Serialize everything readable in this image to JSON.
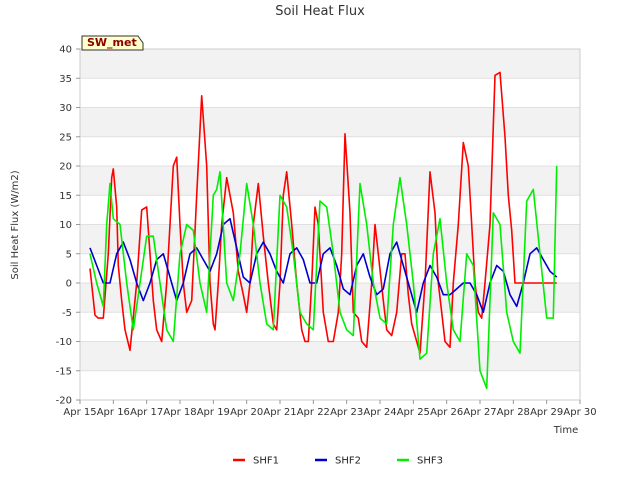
{
  "chart_data": {
    "type": "line",
    "title": "Soil Heat Flux",
    "xlabel": "Time",
    "ylabel": "Soil Heat Flux (W/m2)",
    "site_label": "SW_met",
    "xlim": [
      15,
      30
    ],
    "ylim": [
      -20,
      40
    ],
    "x_ticks": [
      15,
      16,
      17,
      18,
      19,
      20,
      21,
      22,
      23,
      24,
      25,
      26,
      27,
      28,
      29,
      30
    ],
    "x_tick_labels": [
      "Apr 15",
      "Apr 16",
      "Apr 17",
      "Apr 18",
      "Apr 19",
      "Apr 20",
      "Apr 21",
      "Apr 22",
      "Apr 23",
      "Apr 24",
      "Apr 25",
      "Apr 26",
      "Apr 27",
      "Apr 28",
      "Apr 29",
      "Apr 30"
    ],
    "y_ticks": [
      -20,
      -15,
      -10,
      -5,
      0,
      5,
      10,
      15,
      20,
      25,
      30,
      35,
      40
    ],
    "y_tick_labels": [
      "-20",
      "-15",
      "-10",
      "-5",
      "0",
      "5",
      "10",
      "15",
      "20",
      "25",
      "30",
      "35",
      "40"
    ],
    "grid": true,
    "legend_position": "bottom",
    "series": [
      {
        "name": "SHF1",
        "color": "#ff0000",
        "x": [
          15.3,
          15.45,
          15.55,
          15.7,
          15.85,
          15.95,
          16.0,
          16.1,
          16.15,
          16.25,
          16.35,
          16.5,
          16.7,
          16.85,
          17.0,
          17.1,
          17.2,
          17.3,
          17.45,
          17.6,
          17.8,
          17.9,
          18.0,
          18.1,
          18.2,
          18.35,
          18.5,
          18.65,
          18.8,
          18.9,
          19.0,
          19.05,
          19.15,
          19.25,
          19.4,
          19.6,
          19.75,
          19.9,
          20.0,
          20.1,
          20.2,
          20.35,
          20.5,
          20.65,
          20.8,
          20.9,
          21.0,
          21.1,
          21.2,
          21.35,
          21.5,
          21.65,
          21.75,
          21.85,
          21.95,
          22.05,
          22.15,
          22.3,
          22.45,
          22.6,
          22.75,
          22.85,
          22.95,
          23.1,
          23.2,
          23.35,
          23.45,
          23.6,
          23.75,
          23.85,
          23.95,
          24.1,
          24.2,
          24.35,
          24.5,
          24.65,
          24.75,
          24.85,
          24.95,
          25.1,
          25.2,
          25.35,
          25.5,
          25.65,
          25.75,
          25.85,
          25.95,
          26.1,
          26.2,
          26.35,
          26.5,
          26.65,
          26.75,
          26.85,
          26.95,
          27.05,
          27.15,
          27.3,
          27.45,
          27.6,
          27.75,
          27.85,
          27.95,
          28.05,
          28.15,
          28.3,
          28.45,
          28.6,
          28.75,
          28.85,
          28.95,
          29.0,
          29.1,
          29.2,
          29.3
        ],
        "y": [
          2.5,
          -5.5,
          -6,
          -6,
          5,
          18,
          19.5,
          13,
          3,
          -3,
          -8,
          -11.5,
          0,
          12.5,
          13,
          5,
          -3,
          -8,
          -10,
          0,
          20,
          21.5,
          10,
          0,
          -5,
          -3,
          15,
          32,
          20,
          0,
          -7,
          -8,
          0,
          10,
          18,
          12,
          2,
          -2,
          -5,
          0,
          10,
          17,
          8,
          0,
          -7,
          -8,
          0,
          15,
          19,
          10,
          0,
          -8,
          -10,
          -10,
          0,
          13,
          10,
          -5,
          -10,
          -10,
          -5,
          5,
          25.5,
          12,
          -5,
          -6,
          -10,
          -11,
          0,
          10,
          5,
          -3,
          -8,
          -9,
          -5,
          5,
          5,
          -2,
          -7,
          -10,
          -12,
          0,
          19,
          12,
          0,
          -5,
          -10,
          -11,
          0,
          10,
          24,
          20,
          10,
          0,
          -5,
          -6,
          0,
          10,
          35.5,
          36,
          25,
          15,
          9,
          0,
          0,
          0,
          0,
          0,
          0,
          0,
          0,
          0,
          0,
          0,
          0
        ],
        "_note_unused": ""
      },
      {
        "name": "SHF2",
        "color": "#0000cc",
        "x": [
          15.3,
          15.5,
          15.7,
          15.9,
          16.1,
          16.3,
          16.5,
          16.7,
          16.9,
          17.1,
          17.3,
          17.5,
          17.7,
          17.9,
          18.1,
          18.3,
          18.5,
          18.7,
          18.9,
          19.1,
          19.3,
          19.5,
          19.7,
          19.9,
          20.1,
          20.3,
          20.5,
          20.7,
          20.9,
          21.1,
          21.3,
          21.5,
          21.7,
          21.9,
          22.1,
          22.3,
          22.5,
          22.7,
          22.9,
          23.1,
          23.3,
          23.5,
          23.7,
          23.9,
          24.1,
          24.3,
          24.5,
          24.7,
          24.9,
          25.1,
          25.3,
          25.5,
          25.7,
          25.9,
          26.1,
          26.3,
          26.5,
          26.7,
          26.9,
          27.1,
          27.3,
          27.5,
          27.7,
          27.9,
          28.1,
          28.3,
          28.5,
          28.7,
          28.9,
          29.1,
          29.3
        ],
        "y": [
          6,
          3,
          0,
          0,
          5,
          7,
          4,
          0,
          -3,
          0,
          4,
          5,
          1,
          -3,
          0,
          5,
          6,
          4,
          2,
          5,
          10,
          11,
          6,
          1,
          0,
          5,
          7,
          5,
          2,
          0,
          5,
          6,
          4,
          0,
          0,
          5,
          6,
          3,
          -1,
          -2,
          3,
          5,
          1,
          -2,
          -1,
          5,
          7,
          3,
          -1,
          -5,
          0,
          3,
          1,
          -2,
          -2,
          -1,
          0,
          0,
          -2,
          -5,
          0,
          3,
          2,
          -2,
          -4,
          0,
          5,
          6,
          4,
          2,
          1
        ],
        "_note_unused": ""
      },
      {
        "name": "SHF3",
        "color": "#00ee00",
        "x": [
          15.3,
          15.5,
          15.7,
          15.8,
          15.9,
          16.0,
          16.2,
          16.4,
          16.6,
          16.8,
          17.0,
          17.2,
          17.4,
          17.6,
          17.8,
          18.0,
          18.2,
          18.4,
          18.6,
          18.8,
          19.0,
          19.1,
          19.2,
          19.4,
          19.6,
          19.8,
          20.0,
          20.2,
          20.4,
          20.6,
          20.8,
          21.0,
          21.2,
          21.4,
          21.6,
          21.8,
          22.0,
          22.2,
          22.4,
          22.6,
          22.8,
          23.0,
          23.2,
          23.4,
          23.6,
          23.8,
          24.0,
          24.2,
          24.4,
          24.6,
          24.8,
          25.0,
          25.2,
          25.4,
          25.6,
          25.8,
          26.0,
          26.2,
          26.4,
          26.6,
          26.8,
          27.0,
          27.2,
          27.4,
          27.6,
          27.8,
          28.0,
          28.2,
          28.4,
          28.6,
          28.8,
          29.0,
          29.2,
          29.3
        ],
        "y": [
          5,
          0,
          -4,
          10,
          17,
          11,
          10,
          0,
          -8,
          0,
          8,
          8,
          0,
          -8,
          -10,
          5,
          10,
          9,
          0,
          -5,
          15,
          16,
          19,
          0,
          -3,
          5,
          17,
          10,
          0,
          -7,
          -8,
          15,
          13,
          5,
          -5,
          -7,
          -8,
          14,
          13,
          5,
          -5,
          -8,
          -9,
          17,
          10,
          0,
          -6,
          -7,
          10,
          18,
          10,
          0,
          -13,
          -12,
          5,
          11,
          0,
          -8,
          -10,
          5,
          3,
          -15,
          -18,
          12,
          10,
          -5,
          -10,
          -12,
          14,
          16,
          5,
          -6,
          -6,
          20
        ],
        "_note_unused": ""
      }
    ]
  }
}
